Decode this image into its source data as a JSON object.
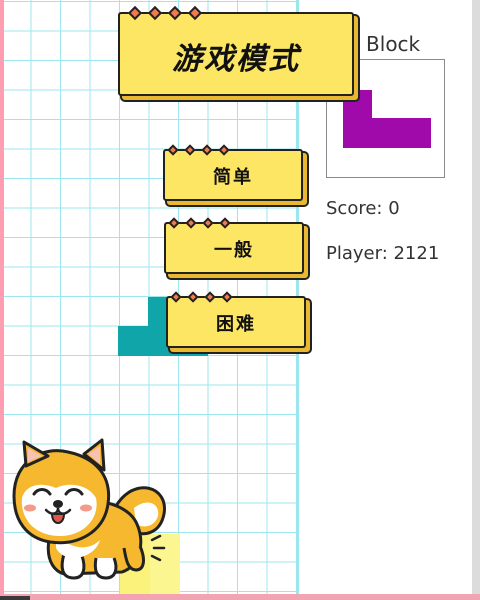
{
  "sidebar": {
    "next_block_label": "xt Block",
    "score_label": "Score: 0",
    "player_label": "Player: 2121"
  },
  "menu": {
    "title": "游戏模式",
    "easy": "简单",
    "normal": "一般",
    "hard": "困难"
  },
  "colors": {
    "grid_line": "#9ce7ee",
    "teal_piece": "#10a5a8",
    "yellow_piece": "#fbf27b",
    "next_piece": "#a00aaa",
    "sign_fill": "#fde663",
    "sign_dot": "#f37a4e"
  },
  "icons": {
    "mascot": "shiba-dog-icon"
  }
}
